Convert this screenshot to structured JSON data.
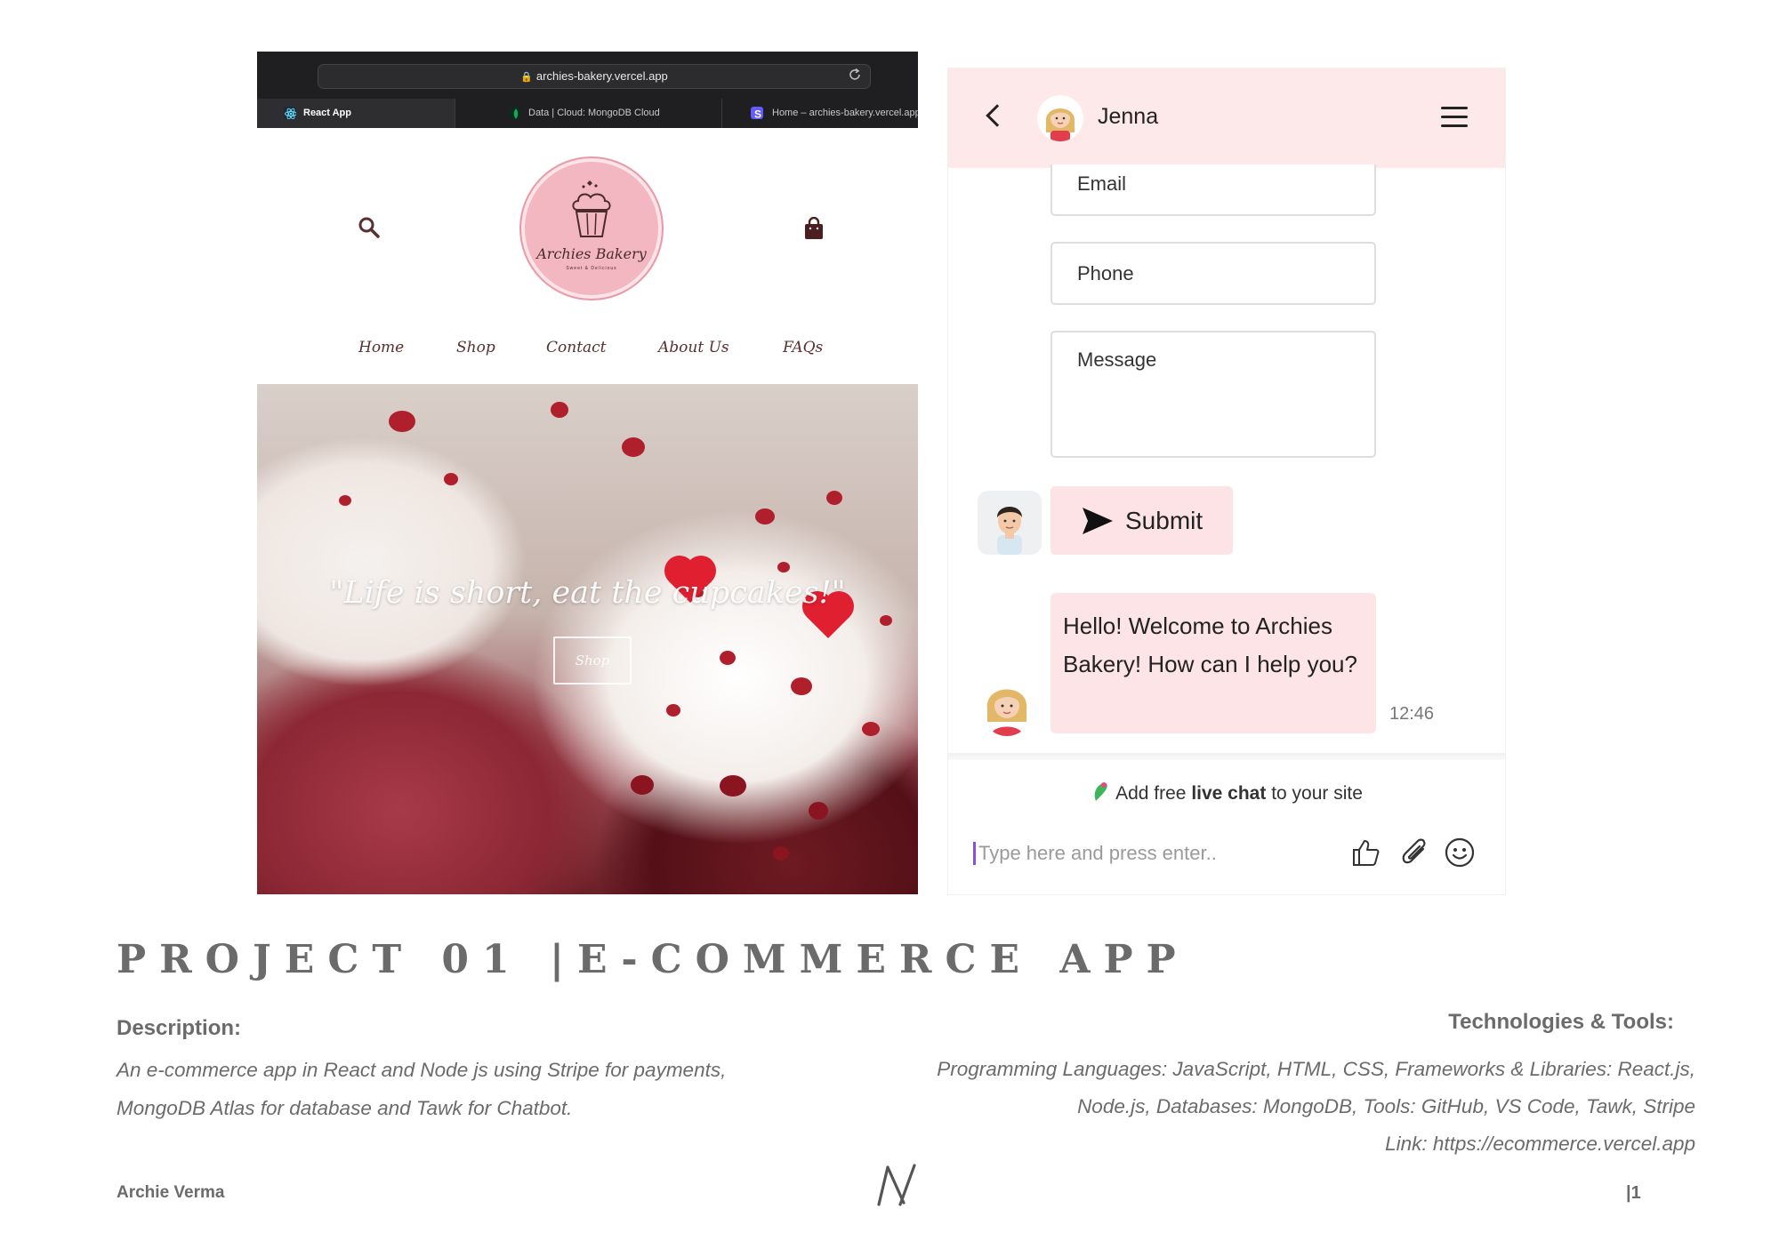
{
  "browser": {
    "url": "archies-bakery.vercel.app",
    "tabs": [
      {
        "label": "React App",
        "active": true,
        "icon": "react-icon",
        "icon_color": "#61dafb"
      },
      {
        "label": "Data | Cloud: MongoDB Cloud",
        "active": false,
        "icon": "mongodb-leaf-icon",
        "icon_color": "#13aa52"
      },
      {
        "label": "Home – archies-bakery.vercel.app",
        "active": false,
        "icon": "stripe-icon",
        "icon_color": "#635bff"
      }
    ]
  },
  "site": {
    "logo": {
      "name": "Archies Bakery",
      "tagline": "Sweet & Delicious",
      "color": "#f2b7c0"
    },
    "nav": [
      "Home",
      "Shop",
      "Contact",
      "About Us",
      "FAQs"
    ],
    "hero": {
      "quote": "\"Life is short, eat the cupcakes!\"",
      "button": "Shop"
    }
  },
  "chat": {
    "agent_name": "Jenna",
    "fields": {
      "email": "Email",
      "phone": "Phone",
      "message": "Message"
    },
    "submit_label": "Submit",
    "message": "Hello! Welcome to Archies Bakery! How can I help you?",
    "time": "12:46",
    "promo": {
      "prefix": "Add free ",
      "bold": "live chat",
      "suffix": " to your site"
    },
    "composer_placeholder": "Type here and press enter..",
    "accent": "#fde8ea"
  },
  "doc": {
    "title": "PROJECT 01 |E-COMMERCE APP",
    "description_heading": "Description:",
    "description_lines": [
      "An e-commerce app in React and Node js using Stripe for payments,",
      "MongoDB Atlas for database and Tawk for Chatbot."
    ],
    "tech_heading": "Technologies & Tools:",
    "tech_lines": [
      "Programming Languages: JavaScript, HTML, CSS, Frameworks & Libraries: React.js,",
      "Node.js, Databases: MongoDB, Tools: GitHub, VS Code, Tawk, Stripe",
      "Link: https://ecommerce.vercel.app"
    ],
    "author": "Archie Verma",
    "page": "|1"
  }
}
